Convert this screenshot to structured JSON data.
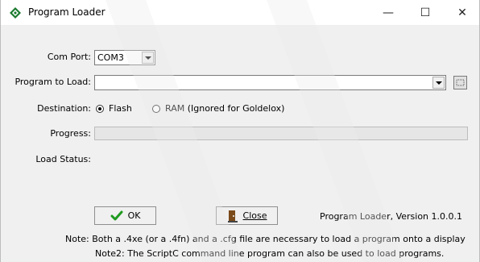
{
  "window": {
    "title": "Program Loader",
    "minimize_glyph": "—",
    "maximize_glyph": "☐",
    "close_glyph": "✕"
  },
  "form": {
    "com_port_label": "Com Port:",
    "com_port_value": "COM3",
    "program_label": "Program to Load:",
    "program_value": "",
    "destination_label": "Destination:",
    "destination_options": [
      "Flash",
      "RAM (Ignored for Goldelox)"
    ],
    "destination_selected": "Flash",
    "progress_label": "Progress:",
    "progress_value": 0,
    "load_status_label": "Load Status:",
    "load_status_value": ""
  },
  "buttons": {
    "ok_label": "OK",
    "close_label": "Close"
  },
  "version_text": "Program Loader, Version 1.0.0.1",
  "notes": {
    "note1": "Note: Both a .4xe (or a .4fn) and a .cfg file are necessary to load a program onto a display",
    "note2": "Note2: The ScriptC command line program can also be used to load programs."
  },
  "icons": {
    "app": "diamond-app-icon",
    "dropdown": "chevron-down-icon",
    "browse": "browse-icon",
    "ok": "checkmark-icon",
    "close": "exit-door-icon"
  }
}
